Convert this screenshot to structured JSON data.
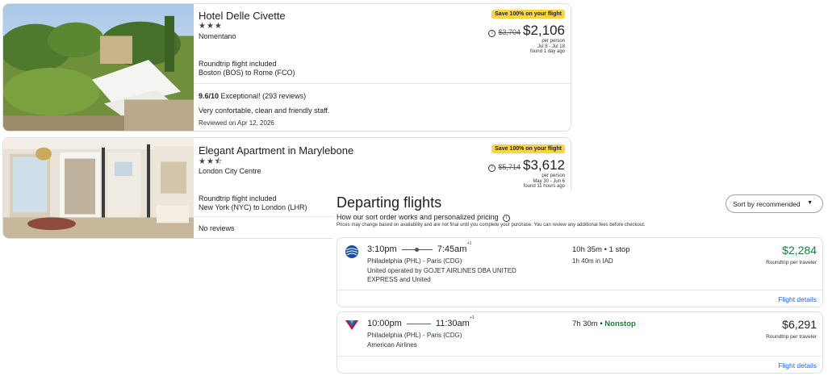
{
  "hotels": [
    {
      "name": "Hotel Delle Civette",
      "stars": "★★★",
      "location": "Nomentano",
      "badge": "Save 100% on your flight",
      "old_price": "$3,704",
      "price": "$2,106",
      "price_lines": [
        "per person",
        "Jul 8 - Jul 18",
        "found 1 day ago"
      ],
      "flight_included": "Roundtrip flight included",
      "route": "Boston (BOS) to Rome (FCO)",
      "rating_score": "9.6/10",
      "rating_text": "Exceptional! (293 reviews)",
      "review": "Very confortable, clean and friendly staff.",
      "reviewed": "Reviewed on Apr 12, 2026"
    },
    {
      "name": "Elegant Apartment in Marylebone",
      "stars": "★★⯪",
      "location": "London City Centre",
      "badge": "Save 100% on your flight",
      "old_price": "$5,714",
      "price": "$3,612",
      "price_lines": [
        "per person",
        "May 30 - Jun 6",
        "found 11 hours ago"
      ],
      "flight_included": "Roundtrip flight included",
      "route": "New York (NYC) to London (LHR)",
      "no_reviews": "No reviews"
    }
  ],
  "flights_panel": {
    "title": "Departing flights",
    "sort_link": "How our sort order works and personalized pricing",
    "note": "Prices may change based on availability and are not final until you complete your purchase. You can review any additional fees before checkout.",
    "sort_label": "Sort by recommended",
    "flights": [
      {
        "depart": "3:10pm",
        "arrive": "7:45am",
        "day_offset": "+1",
        "route": "Philadelphia (PHL) - Paris (CDG)",
        "carrier": "United operated by GOJET AIRLINES DBA UNITED EXPRESS and United",
        "duration": "10h 35m",
        "stops": "1 stop",
        "layover": "1h 40m in IAD",
        "price": "$2,284",
        "price_sub": "Roundtrip per traveler",
        "details": "Flight details"
      },
      {
        "depart": "10:00pm",
        "arrive": "11:30am",
        "day_offset": "+1",
        "route": "Philadelphia (PHL) - Paris (CDG)",
        "carrier": "American Airlines",
        "duration": "7h 30m",
        "stops": "Nonstop",
        "price": "$6,291",
        "price_sub": "Roundtrip per traveler",
        "details": "Flight details"
      }
    ]
  },
  "colors": {
    "badge_yellow": "#ffd53d",
    "price_green": "#188038",
    "link_blue": "#1668e3"
  }
}
